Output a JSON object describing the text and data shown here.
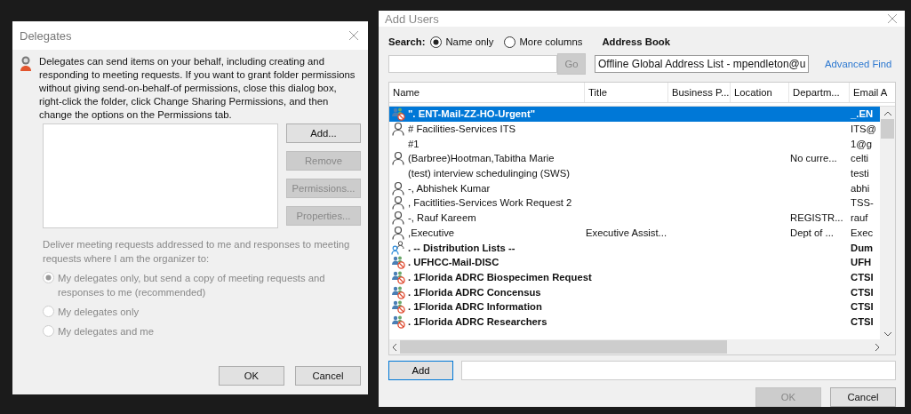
{
  "delegates": {
    "title": "Delegates",
    "description": "Delegates can send items on your behalf, including creating and responding to meeting requests. If you want to grant folder permissions without giving send-on-behalf-of permissions, close this dialog box, right-click the folder, click Change Sharing Permissions, and then change the options on the Permissions tab.",
    "buttons": [
      {
        "label": "Add...",
        "disabled": false
      },
      {
        "label": "Remove",
        "disabled": true
      },
      {
        "label": "Permissions...",
        "disabled": true
      },
      {
        "label": "Properties...",
        "disabled": true
      }
    ],
    "delivery_label": "Deliver meeting requests addressed to me and responses to meeting requests where I am the organizer to:",
    "delivery_disabled": true,
    "options": [
      {
        "label": "My delegates only, but send a copy of meeting requests and responses to me (recommended)",
        "selected": true
      },
      {
        "label": "My delegates only",
        "selected": false
      },
      {
        "label": "My delegates and me",
        "selected": false
      }
    ],
    "footer_buttons": [
      "OK",
      "Cancel"
    ]
  },
  "add_users": {
    "title": "Add Users",
    "search_label": "Search:",
    "search_modes": [
      {
        "label": "Name only",
        "selected": true
      },
      {
        "label": "More columns",
        "selected": false
      }
    ],
    "go_button": {
      "label": "Go",
      "disabled": true
    },
    "address_book_label": "Address Book",
    "address_book": "Offline Global Address List - mpendleton@u",
    "advanced_find": "Advanced Find",
    "columns": [
      "Name",
      "Title",
      "Business P...",
      "Location",
      "Departm...",
      "Email A"
    ],
    "rows": [
      {
        "kind": "group",
        "name": "\". ENT-Mail-ZZ-HO-Urgent\"",
        "bold": true,
        "selected": true,
        "email": "_.EN"
      },
      {
        "kind": "person",
        "name": "# Facilities-Services ITS",
        "bold": false,
        "selected": false,
        "email": "ITS@"
      },
      {
        "kind": "none",
        "name": "#1",
        "bold": false,
        "selected": false,
        "email": "1@g"
      },
      {
        "kind": "person",
        "name": "(Barbree)Hootman,Tabitha Marie",
        "bold": false,
        "selected": false,
        "department": "No curre...",
        "email": "celti"
      },
      {
        "kind": "none",
        "name": "(test) interview schedulinging (SWS)",
        "bold": false,
        "selected": false,
        "email": "testi"
      },
      {
        "kind": "person",
        "name": "-, Abhishek Kumar",
        "bold": false,
        "selected": false,
        "email": "abhi"
      },
      {
        "kind": "person",
        "name": ", Facitlities-Services Work Request 2",
        "bold": false,
        "selected": false,
        "email": "TSS-"
      },
      {
        "kind": "person",
        "name": "-, Rauf Kareem",
        "bold": false,
        "selected": false,
        "department": "REGISTR...",
        "email": "rauf"
      },
      {
        "kind": "person",
        "name": ",Executive",
        "bold": false,
        "selected": false,
        "title": "Executive Assist...",
        "department": "Dept of ...",
        "email": "Exec"
      },
      {
        "kind": "contacts",
        "name": ". -- Distribution Lists --",
        "bold": true,
        "selected": false,
        "email": "Dum"
      },
      {
        "kind": "group",
        "name": ".  UFHCC-Mail-DISC",
        "bold": true,
        "selected": false,
        "email": "UFH"
      },
      {
        "kind": "group",
        "name": ". 1Florida ADRC Biospecimen Request",
        "bold": true,
        "selected": false,
        "email": "CTSI"
      },
      {
        "kind": "group",
        "name": ". 1Florida ADRC Concensus",
        "bold": true,
        "selected": false,
        "email": "CTSI"
      },
      {
        "kind": "group",
        "name": ". 1Florida ADRC Information",
        "bold": true,
        "selected": false,
        "email": "CTSI"
      },
      {
        "kind": "group",
        "name": ". 1Florida ADRC Researchers",
        "bold": true,
        "selected": false,
        "email": "CTSI"
      }
    ],
    "add_button": "Add",
    "ok_button": {
      "label": "OK",
      "disabled": true
    },
    "cancel_button": "Cancel"
  }
}
